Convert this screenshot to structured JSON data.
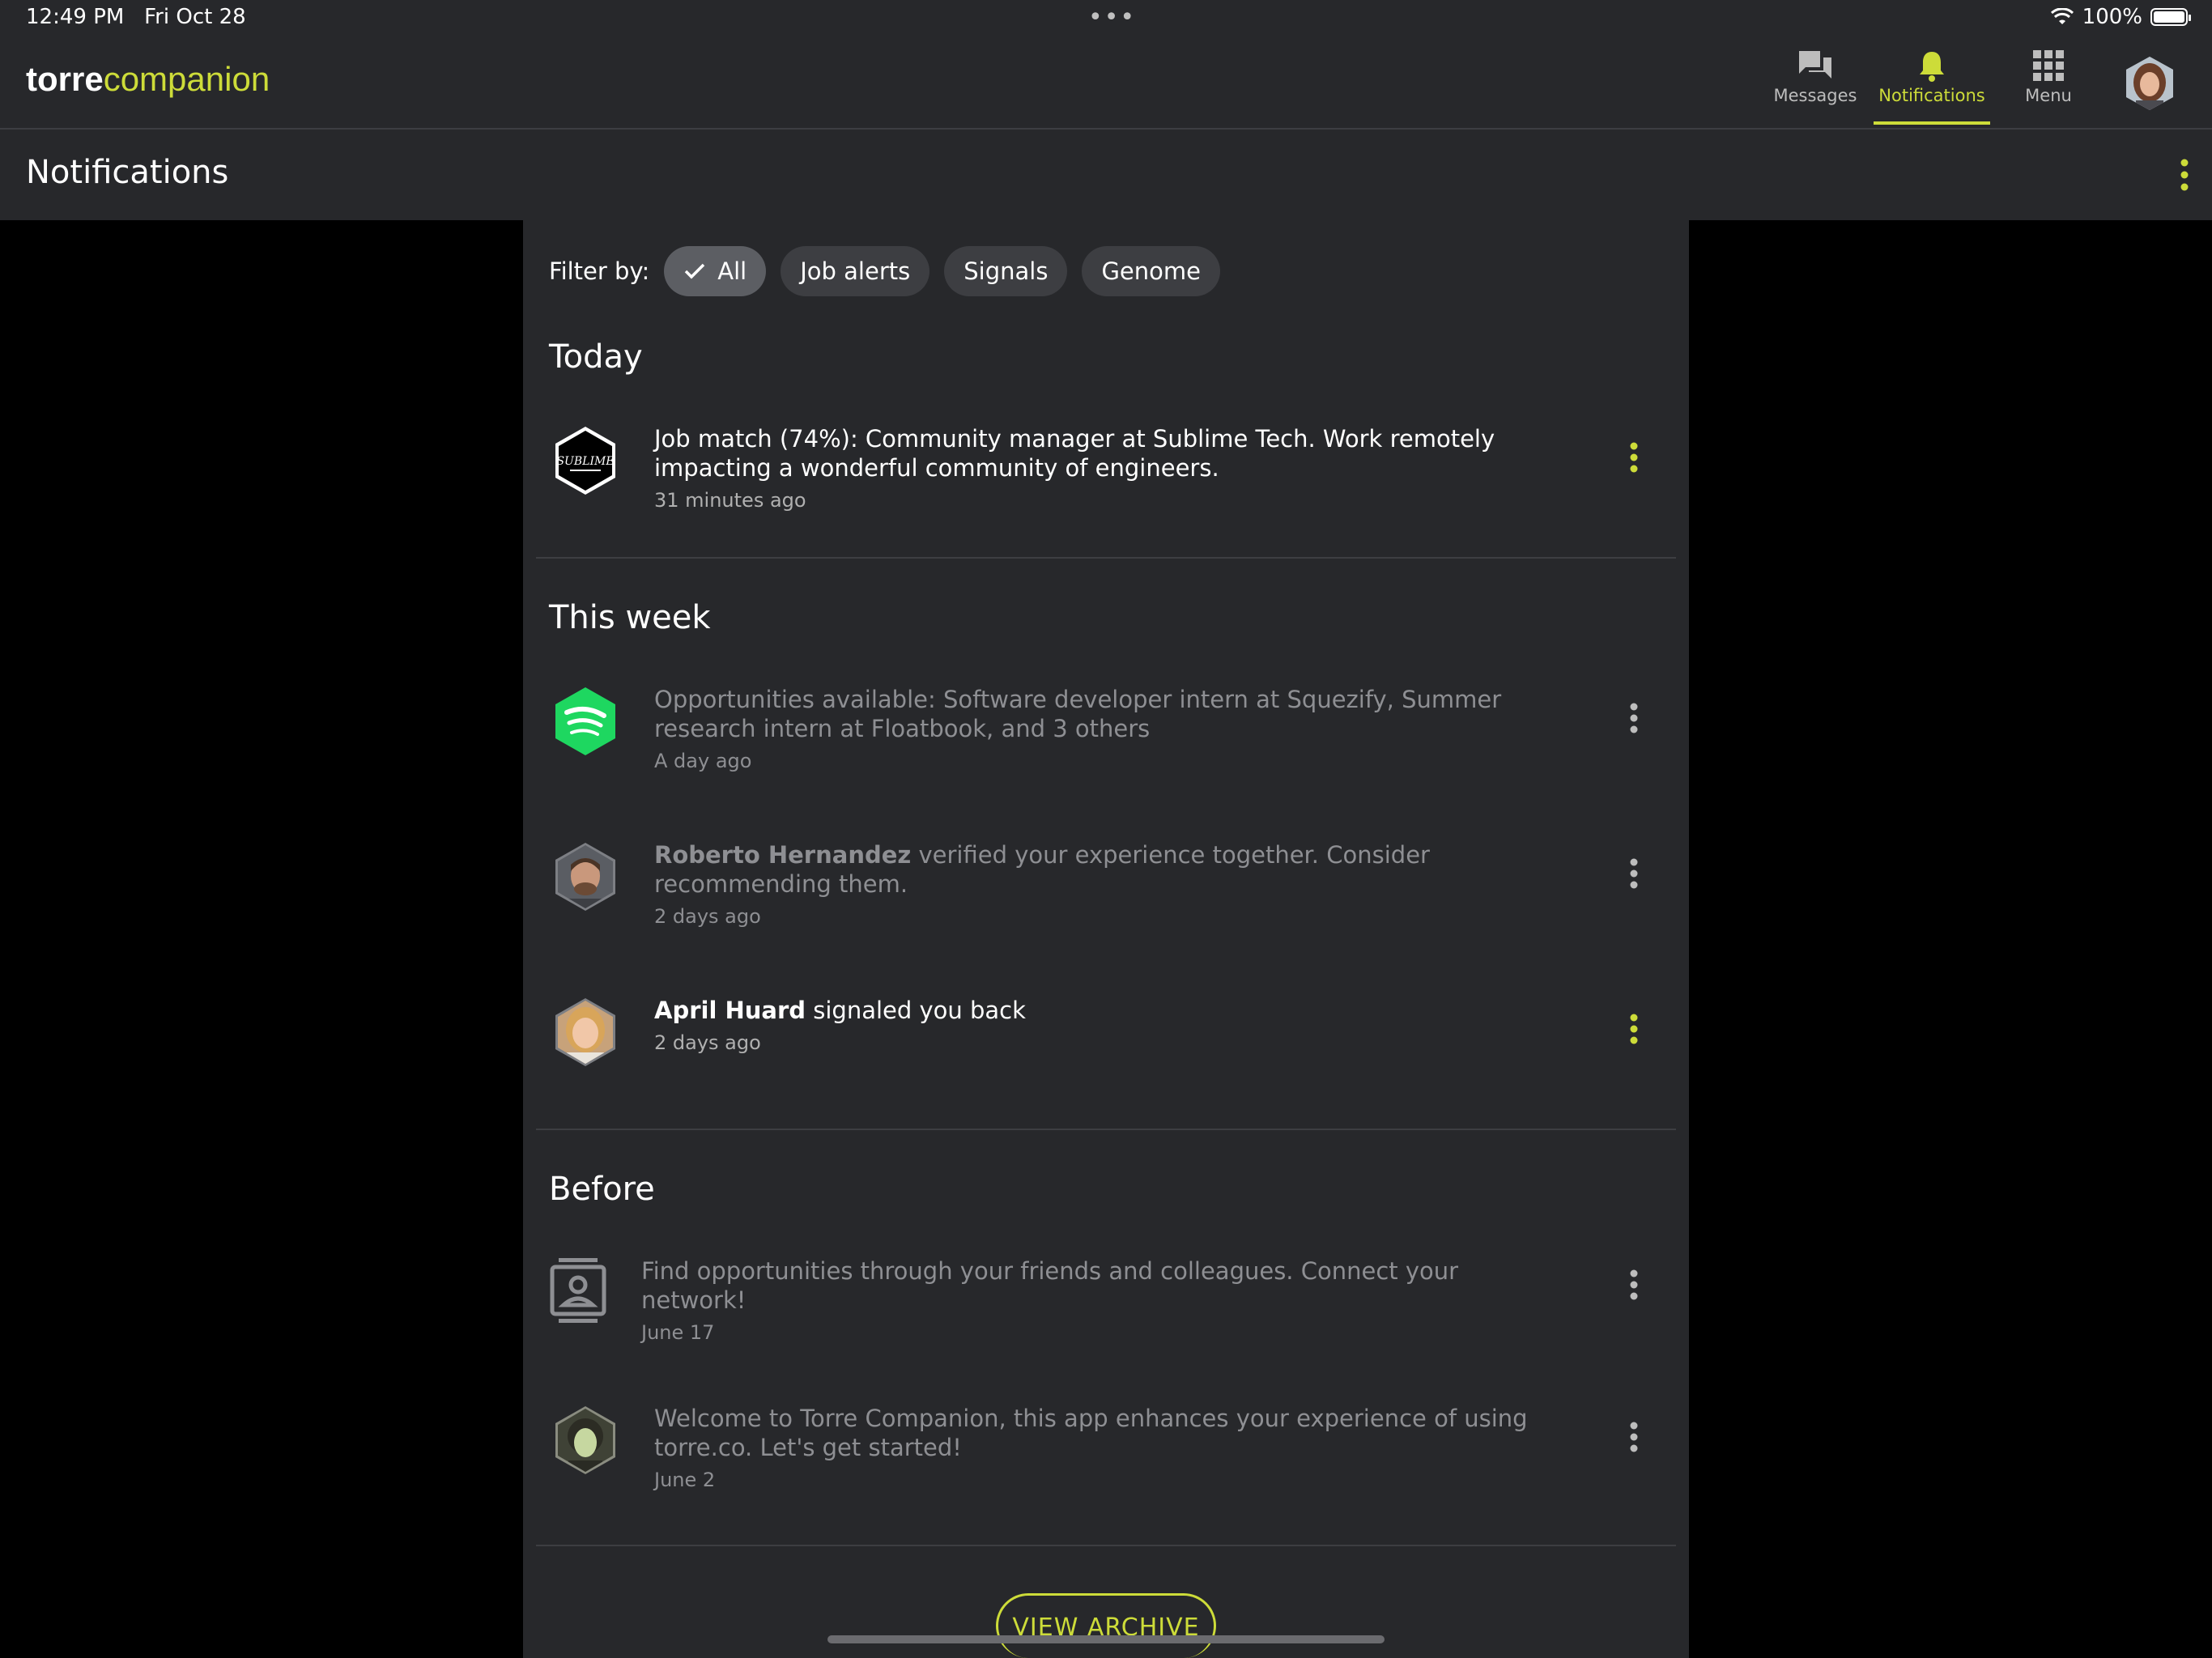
{
  "status_bar": {
    "time": "12:49 PM",
    "date": "Fri Oct 28",
    "battery": "100%"
  },
  "app": {
    "logo_bold": "torre",
    "logo_light": "companion"
  },
  "nav": {
    "messages": "Messages",
    "notifications": "Notifications",
    "menu": "Menu"
  },
  "page": {
    "title": "Notifications"
  },
  "filters": {
    "label": "Filter by:",
    "chips": [
      "All",
      "Job alerts",
      "Signals",
      "Genome"
    ],
    "selected": "All"
  },
  "sections": {
    "today": "Today",
    "this_week": "This week",
    "before": "Before"
  },
  "notifications": [
    {
      "text": "Job match (74%): Community manager at Sublime Tech. Work remotely impacting a wonderful community of engineers.",
      "time": "31 minutes ago",
      "logo_text": "SUBLIME"
    },
    {
      "text": "Opportunities available: Software developer intern at Squezify, Summer research intern at Floatbook, and 3 others",
      "time": "A day ago"
    },
    {
      "name": "Roberto Hernandez",
      "text": " verified your experience together. Consider recommending them.",
      "time": "2 days ago"
    },
    {
      "name": "April Huard",
      "text": " signaled you back",
      "time": "2 days ago"
    },
    {
      "text": "Find opportunities through your friends and colleagues. Connect your network!",
      "time": "June 17"
    },
    {
      "text": "Welcome to Torre Companion, this app enhances your experience of using torre.co. Let's get started!",
      "time": "June 2"
    }
  ],
  "archive_button": "VIEW ARCHIVE",
  "colors": {
    "accent": "#cddc39",
    "surface": "#27282b",
    "background": "#000000",
    "spotify": "#1ed760"
  }
}
